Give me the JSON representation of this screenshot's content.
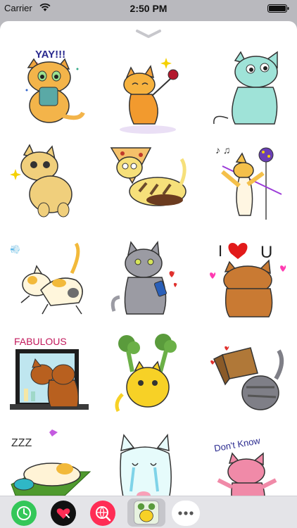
{
  "status_bar": {
    "carrier": "Carrier",
    "time": "2:50 PM"
  },
  "stickers": [
    {
      "id": "yay",
      "caption": "YAY!!!"
    },
    {
      "id": "rose-dance",
      "caption": ""
    },
    {
      "id": "shy-blue-cat",
      "caption": ""
    },
    {
      "id": "happy-tabby",
      "caption": ""
    },
    {
      "id": "pizza-cat",
      "caption": ""
    },
    {
      "id": "lollipop-music",
      "caption": ""
    },
    {
      "id": "stretching-calico",
      "caption": ""
    },
    {
      "id": "gray-cat-phone",
      "caption": ""
    },
    {
      "id": "i-love-you",
      "caption_top": "I",
      "caption_end": "U"
    },
    {
      "id": "fabulous",
      "caption": "FABULOUS"
    },
    {
      "id": "broccoli-cat",
      "caption": ""
    },
    {
      "id": "box-cat",
      "caption": ""
    },
    {
      "id": "sleeping-cat",
      "caption": "ZZZ"
    },
    {
      "id": "crying-ghost-cat",
      "caption": ""
    },
    {
      "id": "dont-know",
      "caption": "Don't Know"
    }
  ],
  "app_strip": {
    "apps": [
      {
        "name": "recents",
        "color": "#34c759"
      },
      {
        "name": "digital-touch",
        "color": "#111111"
      },
      {
        "name": "web-images",
        "color": "#ff2d55"
      },
      {
        "name": "cat-stickers",
        "color": "#c6c6cb"
      },
      {
        "name": "more",
        "color": "#ffffff"
      }
    ]
  },
  "colors": {
    "sheet": "#ffffff",
    "backdrop": "#b9b9be",
    "strip": "#e4e4e8"
  }
}
